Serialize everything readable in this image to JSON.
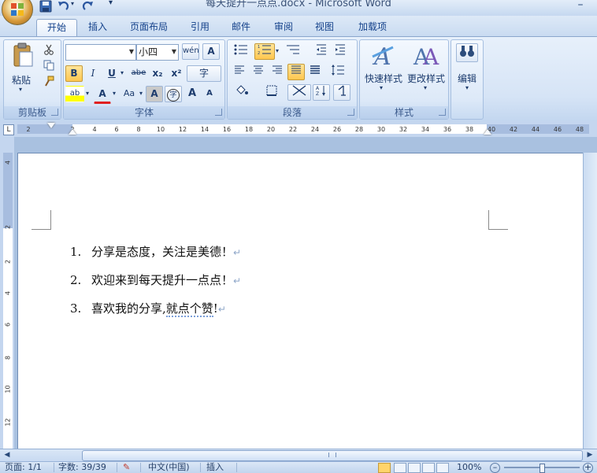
{
  "window": {
    "title": "每天提升一点点.docx - Microsoft Word",
    "minimize_glyph": "–"
  },
  "quick_access": {
    "save_glyph": "💾",
    "undo_glyph": "↶",
    "redo_glyph": "↻",
    "customize_glyph": "▾"
  },
  "tabs": [
    {
      "label": "开始",
      "active": true
    },
    {
      "label": "插入"
    },
    {
      "label": "页面布局"
    },
    {
      "label": "引用"
    },
    {
      "label": "邮件"
    },
    {
      "label": "审阅"
    },
    {
      "label": "视图"
    },
    {
      "label": "加载项"
    }
  ],
  "ribbon": {
    "clipboard": {
      "label": "剪贴板",
      "paste_label": "粘贴"
    },
    "font": {
      "label": "字体",
      "font_name": "",
      "font_size": "小四",
      "bold": "B",
      "italic": "I",
      "underline": "U",
      "strike": "abe",
      "sub": "x₂",
      "sup": "x²",
      "change_case": "Aa",
      "char_shading": "A",
      "enclose": "字",
      "grow": "A",
      "wen": "wén",
      "font_color": "A",
      "highlight": "ab",
      "clear_format": "A"
    },
    "paragraph": {
      "label": "段落"
    },
    "styles": {
      "label": "样式",
      "quick_styles": "快速样式",
      "change_styles": "更改样式"
    },
    "editing": {
      "label": "编辑"
    }
  },
  "ruler": {
    "ticks": [
      "2",
      "2",
      "4",
      "6",
      "8",
      "10",
      "12",
      "14",
      "16",
      "18",
      "20",
      "22",
      "24",
      "26",
      "28",
      "30",
      "32",
      "34",
      "36",
      "38",
      "40",
      "42",
      "44",
      "46",
      "48"
    ],
    "corner": "L",
    "vticks": [
      "4",
      "2",
      "2",
      "4",
      "6",
      "8",
      "10",
      "12"
    ]
  },
  "document": {
    "items": [
      {
        "num": "1.",
        "text": "分享是态度，关注是美德！"
      },
      {
        "num": "2.",
        "text": "欢迎来到每天提升一点点！"
      },
      {
        "num": "3.",
        "text_a": "喜欢我的分享,",
        "text_b": "就点个赞",
        "text_c": "!"
      }
    ],
    "para_mark": "↵"
  },
  "status": {
    "page": "页面: 1/1",
    "words": "字数: 39/39",
    "lang": "中文(中国)",
    "mode": "插入",
    "zoom": "100%",
    "zoom_fraction": 0.5
  }
}
